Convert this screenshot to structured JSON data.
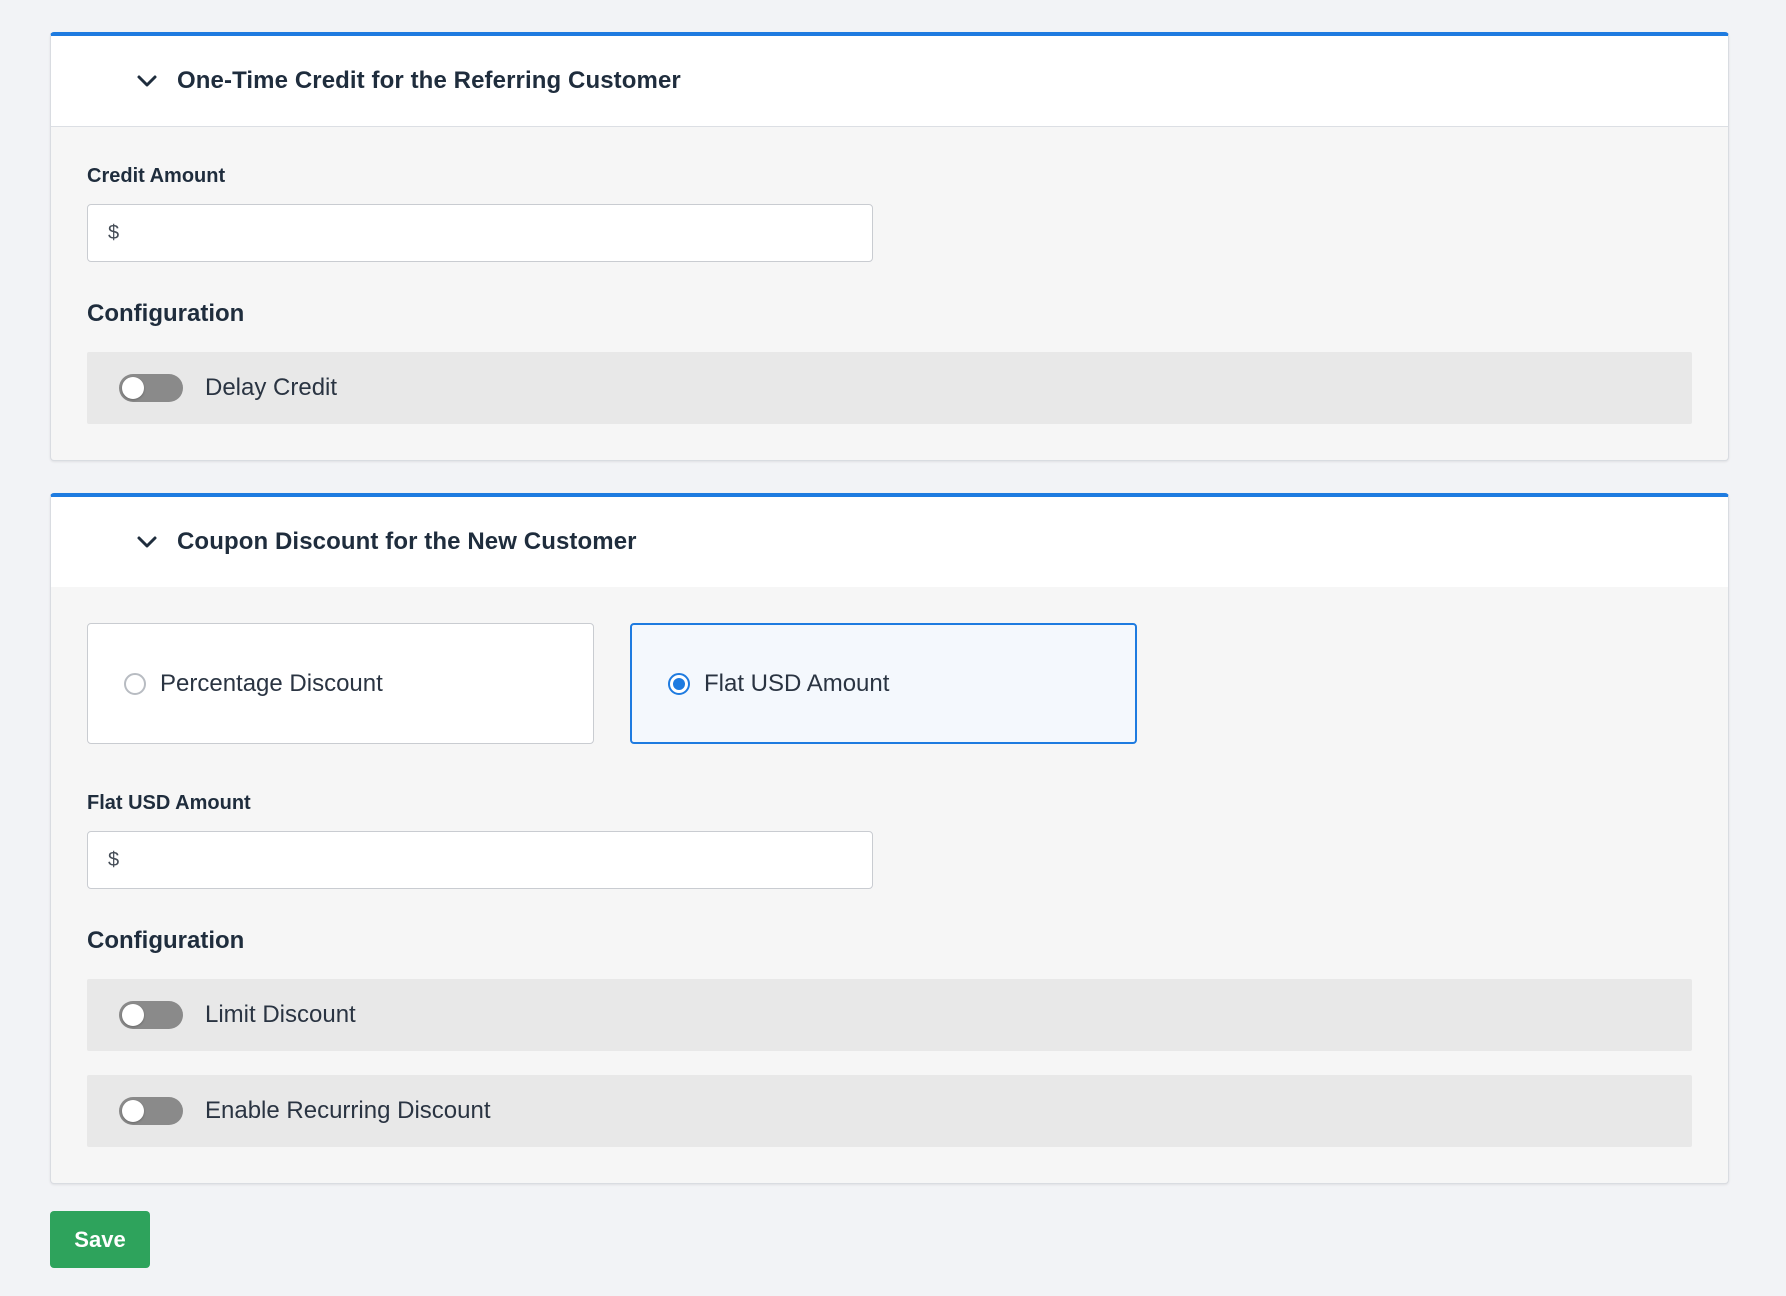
{
  "referrer_panel": {
    "title": "One-Time Credit for the Referring Customer",
    "chevron_icon": "chevron-down-icon",
    "credit_amount": {
      "label": "Credit Amount",
      "currency_symbol": "$",
      "value": ""
    },
    "configuration": {
      "heading": "Configuration",
      "toggles": [
        {
          "label": "Delay Credit",
          "enabled": false
        }
      ]
    }
  },
  "new_customer_panel": {
    "title": "Coupon Discount for the New Customer",
    "chevron_icon": "chevron-down-icon",
    "discount_type": {
      "options": [
        {
          "label": "Percentage Discount",
          "selected": false
        },
        {
          "label": "Flat USD Amount",
          "selected": true
        }
      ]
    },
    "flat_amount": {
      "label": "Flat USD Amount",
      "currency_symbol": "$",
      "value": ""
    },
    "configuration": {
      "heading": "Configuration",
      "toggles": [
        {
          "label": "Limit Discount",
          "enabled": false
        },
        {
          "label": "Enable Recurring Discount",
          "enabled": false
        }
      ]
    }
  },
  "actions": {
    "save_label": "Save"
  },
  "colors": {
    "accent": "#1e7be0",
    "save_button": "#2ea35c",
    "toggle_off": "#8a8a8a",
    "page_background": "#f2f3f6"
  }
}
